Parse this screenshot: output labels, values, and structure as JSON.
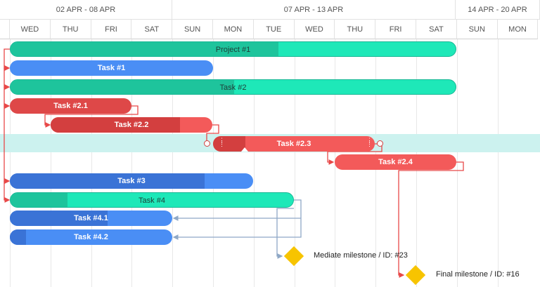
{
  "timeline": {
    "weeks": [
      {
        "label": "02 APR - 08 APR"
      },
      {
        "label": "07 APR - 13 APR"
      },
      {
        "label": "14 APR - 20 APR"
      }
    ],
    "days": [
      "WED",
      "THU",
      "FRI",
      "SAT",
      "SUN",
      "MON",
      "TUE",
      "WED",
      "THU",
      "FRI",
      "SAT",
      "SUN",
      "MON"
    ]
  },
  "tasks": [
    {
      "id": "project-1",
      "label": "Project #1",
      "color": "teal",
      "progress": 0.6
    },
    {
      "id": "task-1",
      "label": "Task #1",
      "color": "blue",
      "progress": 0
    },
    {
      "id": "task-2",
      "label": "Task #2",
      "color": "teal",
      "progress": 0.5
    },
    {
      "id": "task-2-1",
      "label": "Task #2.1",
      "color": "red",
      "progress": 0
    },
    {
      "id": "task-2-2",
      "label": "Task #2.2",
      "color": "red",
      "progress": 0.8
    },
    {
      "id": "task-2-3",
      "label": "Task #2.3",
      "color": "red",
      "progress": 0.2,
      "selected": true
    },
    {
      "id": "task-2-4",
      "label": "Task #2.4",
      "color": "red",
      "progress": 0
    },
    {
      "id": "task-3",
      "label": "Task #3",
      "color": "blue",
      "progress": 0.8
    },
    {
      "id": "task-4",
      "label": "Task #4",
      "color": "teal",
      "progress": 0.2
    },
    {
      "id": "task-4-1",
      "label": "Task #4.1",
      "color": "blue",
      "progress": 0.6
    },
    {
      "id": "task-4-2",
      "label": "Task #4.2",
      "color": "blue",
      "progress": 0.1
    }
  ],
  "milestones": [
    {
      "id": "milestone-23",
      "label": "Mediate milestone / ID: #23"
    },
    {
      "id": "milestone-16",
      "label": "Final milestone / ID: #16"
    }
  ],
  "colors": {
    "red_link": "#e84848",
    "blue_link": "#8fa8c6",
    "selected_row": "#ccf2ef",
    "milestone": "#f7c400"
  }
}
